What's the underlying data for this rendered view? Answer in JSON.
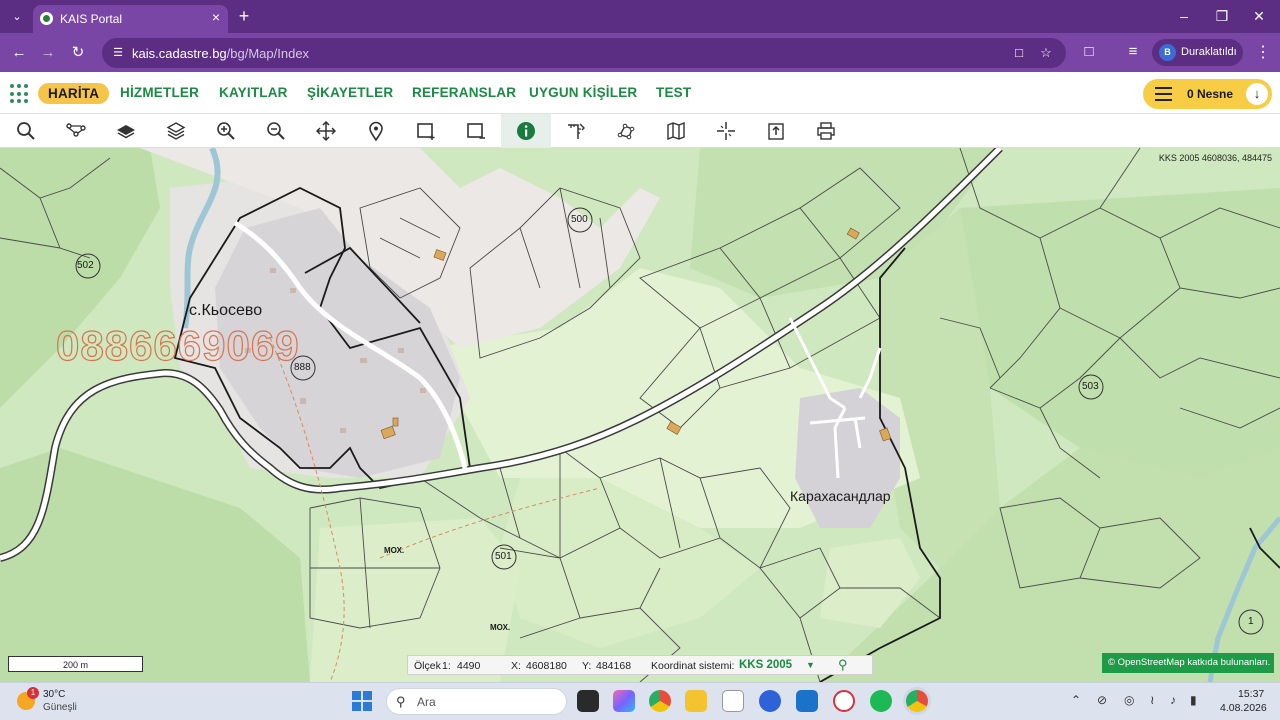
{
  "browser": {
    "tab_title": "KAIS Portal",
    "url_host": "kais.cadastre.bg",
    "url_path": "/bg/Map/Index",
    "profile_initial": "B",
    "profile_label": "Duraklatıldı"
  },
  "site_menu": {
    "items": [
      {
        "label": "HARİTA",
        "active": true
      },
      {
        "label": "HİZMETLER"
      },
      {
        "label": "KAYITLAR"
      },
      {
        "label": "ŞİKAYETLER"
      },
      {
        "label": "REFERANSLAR"
      },
      {
        "label": "UYGUN KİŞİLER"
      },
      {
        "label": "TEST"
      }
    ],
    "object_count_label": "0 Nesne"
  },
  "map_tools": [
    "search-icon",
    "route-icon",
    "layer-icon",
    "layers-icon",
    "zoom-in-icon",
    "zoom-out-icon",
    "pan-icon",
    "pin-icon",
    "select-area-icon",
    "deselect-area-icon",
    "info-icon",
    "measure-icon",
    "polygon-icon",
    "map-icon",
    "crosshair-icon",
    "export-icon",
    "print-icon"
  ],
  "map": {
    "top_coordinates": "KKS 2005 4608036, 484475",
    "watermark": "0886669069",
    "villages": [
      "с.Кьосево",
      "Карахасандлар"
    ],
    "parcel_numbers": [
      "502",
      "500",
      "888",
      "503",
      "501",
      "1"
    ],
    "small_labels": [
      "МОХ.",
      "МОХ."
    ],
    "scale_label": "200 m",
    "status": {
      "scale_label": "Ölçek",
      "scale_prefix": "1:",
      "scale_value": "4490",
      "x_label": "X:",
      "x_value": "4608180",
      "y_label": "Y:",
      "y_value": "484168",
      "crs_label": "Koordinat sistemi:",
      "crs_value": "KKS 2005"
    },
    "attribution": "© OpenStreetMap  katkıda bulunanları."
  },
  "taskbar": {
    "weather_badge": "1",
    "weather_temp": "30°C",
    "weather_condition": "Güneşli",
    "search_placeholder": "Ara",
    "time": "15:37",
    "date": "4.08.2026"
  },
  "colors": {
    "browser_frame": "#5b2d83",
    "menu_green": "#1b8a43",
    "active_yellow": "#f5c54a",
    "map_green": "#cfe8bf",
    "osm_badge": "#1e9b46"
  }
}
